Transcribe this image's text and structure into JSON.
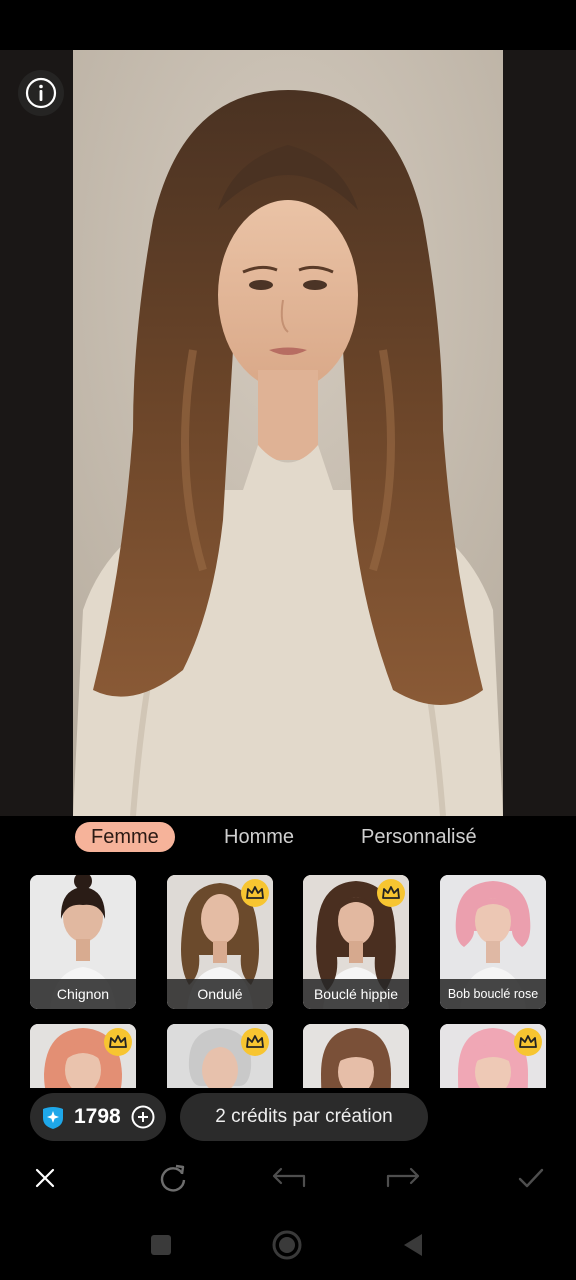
{
  "tabs": [
    {
      "label": "Femme",
      "active": true
    },
    {
      "label": "Homme",
      "active": false
    },
    {
      "label": "Personnalisé",
      "active": false
    }
  ],
  "styles_row1": [
    {
      "label": "Chignon",
      "premium": false
    },
    {
      "label": "Ondulé",
      "premium": true
    },
    {
      "label": "Bouclé hippie",
      "premium": true
    },
    {
      "label": "Bob bouclé rose",
      "premium": false
    }
  ],
  "styles_row2": [
    {
      "premium": true
    },
    {
      "premium": true
    },
    {
      "premium": false
    },
    {
      "premium": true
    }
  ],
  "credits": {
    "balance": "1798",
    "cost_hint": "2 crédits par création"
  },
  "icons": {
    "info": "info-icon",
    "crown": "crown-icon",
    "credit": "credit-gem-icon",
    "add": "add-circle-icon",
    "close": "close-icon",
    "regenerate": "refresh-icon",
    "undo": "undo-icon",
    "redo": "redo-icon",
    "confirm": "check-icon"
  },
  "colors": {
    "accent_tab": "#f6b39a",
    "crown_badge": "#f7c531",
    "pill_bg": "#2b2b2b"
  }
}
